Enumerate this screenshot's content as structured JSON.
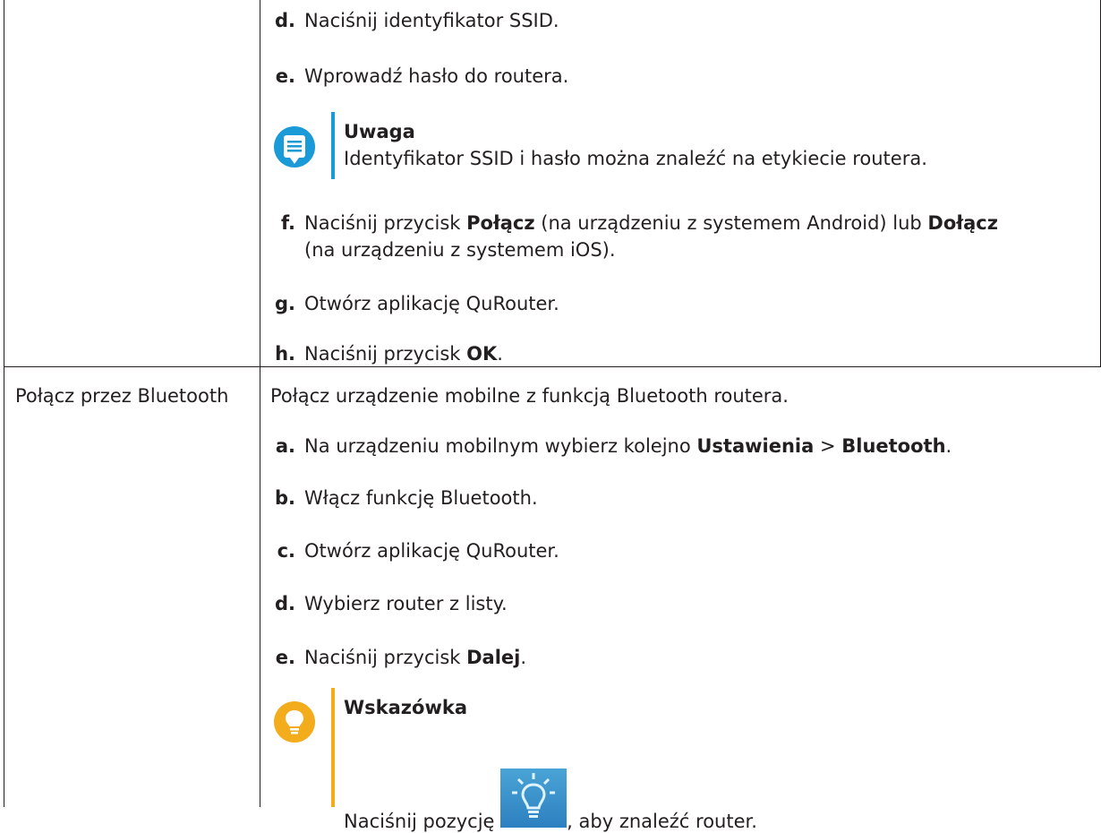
{
  "table": {
    "row2_label": "Połącz przez Bluetooth",
    "row2_intro": "Połącz urządzenie mobilne z funkcją Bluetooth routera."
  },
  "steps_top": [
    {
      "letter": "d.",
      "parts": [
        {
          "t": "Naciśnij identyfikator SSID.",
          "b": false
        }
      ]
    },
    {
      "letter": "e.",
      "parts": [
        {
          "t": "Wprowadź hasło do routera.",
          "b": false
        }
      ]
    },
    {
      "letter": "f.",
      "parts": [
        {
          "t": "Naciśnij przycisk ",
          "b": false
        },
        {
          "t": "Połącz",
          "b": true
        },
        {
          "t": " (na urządzeniu z systemem Android) lub ",
          "b": false
        },
        {
          "t": "Dołącz",
          "b": true
        }
      ],
      "line2": "(na urządzeniu z systemem iOS)."
    },
    {
      "letter": "g.",
      "parts": [
        {
          "t": "Otwórz aplikację QuRouter.",
          "b": false
        }
      ]
    },
    {
      "letter": "h.",
      "parts": [
        {
          "t": "Naciśnij przycisk ",
          "b": false
        },
        {
          "t": "OK",
          "b": true
        },
        {
          "t": ".",
          "b": false
        }
      ]
    }
  ],
  "steps_bottom": [
    {
      "letter": "a.",
      "parts": [
        {
          "t": "Na urządzeniu mobilnym wybierz kolejno ",
          "b": false
        },
        {
          "t": "Ustawienia",
          "b": true
        },
        {
          "t": " > ",
          "b": false
        },
        {
          "t": "Bluetooth",
          "b": true
        },
        {
          "t": ".",
          "b": false
        }
      ]
    },
    {
      "letter": "b.",
      "parts": [
        {
          "t": "Włącz funkcję Bluetooth.",
          "b": false
        }
      ]
    },
    {
      "letter": "c.",
      "parts": [
        {
          "t": "Otwórz aplikację QuRouter.",
          "b": false
        }
      ]
    },
    {
      "letter": "d.",
      "parts": [
        {
          "t": "Wybierz router z listy.",
          "b": false
        }
      ]
    },
    {
      "letter": "e.",
      "parts": [
        {
          "t": "Naciśnij przycisk ",
          "b": false
        },
        {
          "t": "Dalej",
          "b": true
        },
        {
          "t": ".",
          "b": false
        }
      ]
    }
  ],
  "note": {
    "title": "Uwaga",
    "text": "Identyfikator SSID i hasło można znaleźć na etykiecie routera.",
    "icon": "note-icon",
    "color": "#1a9ad6"
  },
  "tip": {
    "title": "Wskazówka",
    "text_before": "Naciśnij pozycję ",
    "text_after": ", aby znaleźć router.",
    "icon": "lightbulb-icon",
    "color": "#f2ac1c"
  }
}
